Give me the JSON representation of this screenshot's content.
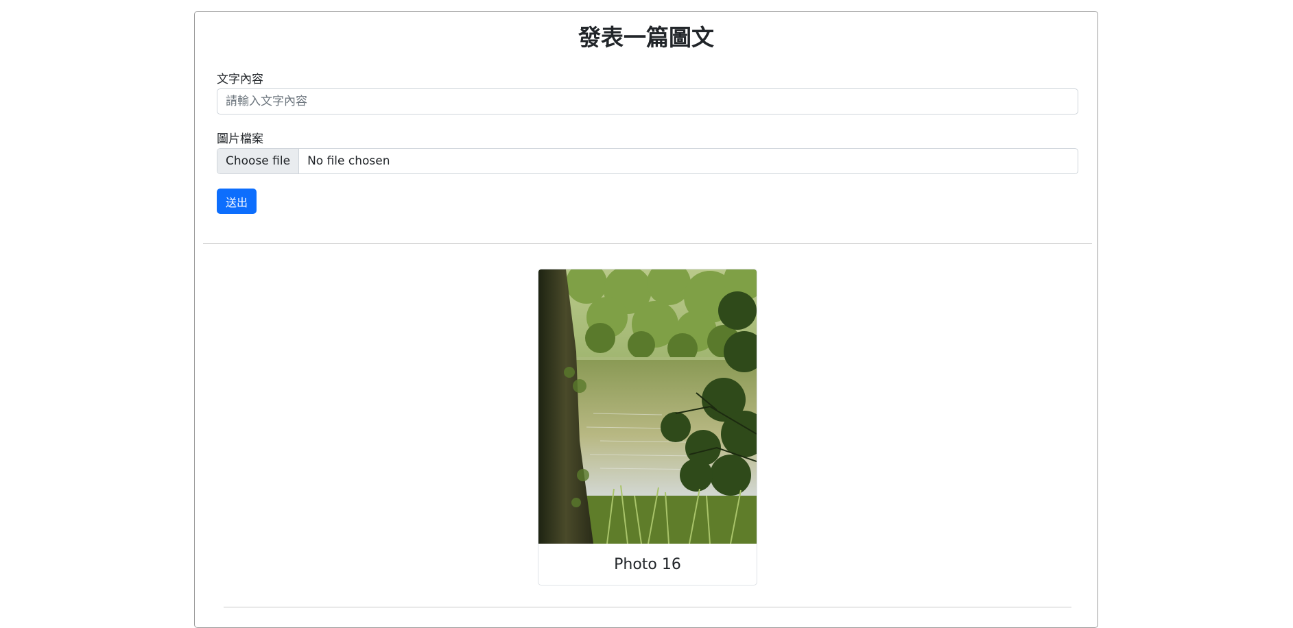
{
  "page": {
    "title": "發表一篇圖文"
  },
  "form": {
    "text_label": "文字內容",
    "text_placeholder": "請輸入文字內容",
    "text_value": "",
    "file_label": "圖片檔案",
    "file_button_label": "Choose file",
    "file_status": "No file chosen",
    "submit_label": "送出"
  },
  "posts": [
    {
      "caption": "Photo 16",
      "image_alt": "lakeside forest with tree trunk and foliage"
    }
  ],
  "colors": {
    "primary": "#0d6efd",
    "border": "#ced4da",
    "file_button_bg": "#e9ecef",
    "text": "#212529"
  }
}
